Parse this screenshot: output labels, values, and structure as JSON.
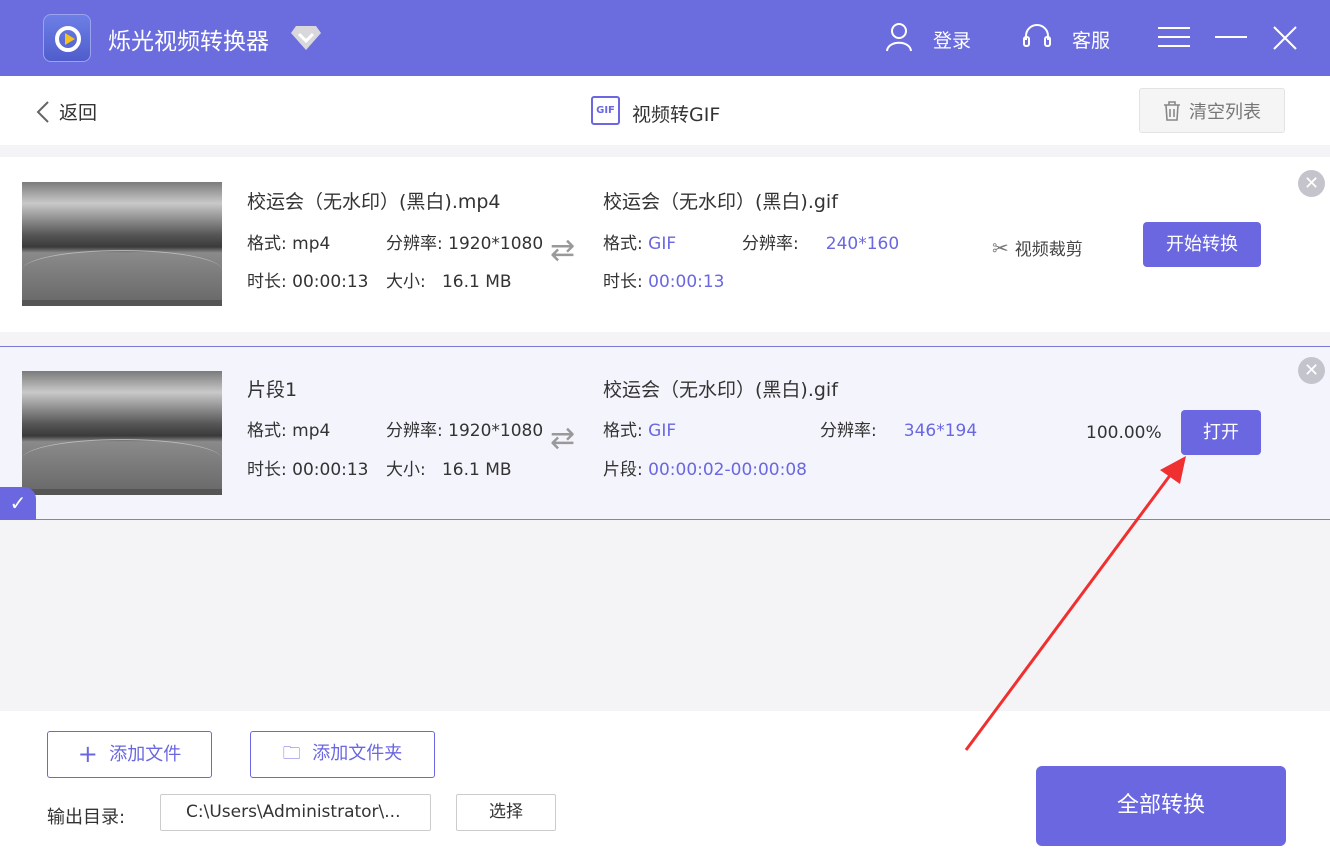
{
  "app": {
    "title": "烁光视频转换器",
    "login": "登录",
    "service": "客服"
  },
  "sub": {
    "back": "返回",
    "title": "视频转GIF",
    "gif_badge": "GIF",
    "clear": "清空列表"
  },
  "items": [
    {
      "source_name": "校运会（无水印）(黑白).mp4",
      "format_label": "格式:",
      "format": "mp4",
      "res_label": "分辨率:",
      "res": "1920*1080",
      "dur_label": "时长:",
      "dur": "00:00:13",
      "size_label": "大小:",
      "size": "16.1 MB",
      "out_name": "校运会（无水印）(黑白).gif",
      "out_format": "GIF",
      "out_res": "240*160",
      "out_extra_label": "时长:",
      "out_extra": "00:00:13",
      "trim": "视频裁剪",
      "action": "开始转换"
    },
    {
      "source_name": "片段1",
      "format_label": "格式:",
      "format": "mp4",
      "res_label": "分辨率:",
      "res": "1920*1080",
      "dur_label": "时长:",
      "dur": "00:00:13",
      "size_label": "大小:",
      "size": "16.1 MB",
      "out_name": "校运会（无水印）(黑白).gif",
      "out_format": "GIF",
      "out_res": "346*194",
      "out_extra_label": "片段:",
      "out_extra": "00:00:02-00:00:08",
      "progress": "100.00%",
      "action": "打开"
    }
  ],
  "bottom": {
    "add_file": "添加文件",
    "add_folder": "添加文件夹",
    "output_label": "输出目录:",
    "output_path": "C:\\Users\\Administrator\\...",
    "choose": "选择",
    "convert_all": "全部转换"
  },
  "colors": {
    "accent": "#6a67e0",
    "header": "#6b6ddf",
    "annotation": "#f03030"
  }
}
